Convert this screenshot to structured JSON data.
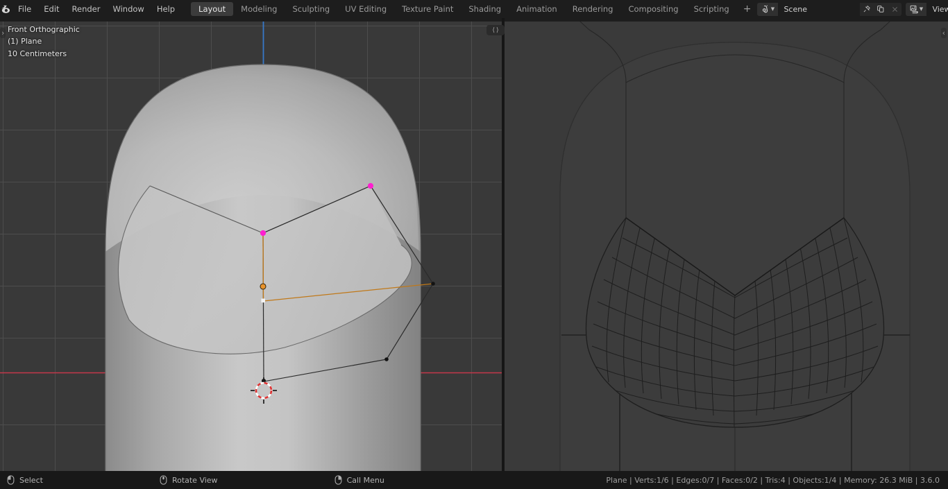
{
  "app": {
    "name": "Blender",
    "version_label": "3.6.0"
  },
  "topbar": {
    "logo_icon": "blender-logo-icon",
    "menus": [
      "File",
      "Edit",
      "Render",
      "Window",
      "Help"
    ],
    "workspace_tabs": [
      {
        "label": "Layout",
        "active": true
      },
      {
        "label": "Modeling",
        "active": false
      },
      {
        "label": "Sculpting",
        "active": false
      },
      {
        "label": "UV Editing",
        "active": false
      },
      {
        "label": "Texture Paint",
        "active": false
      },
      {
        "label": "Shading",
        "active": false
      },
      {
        "label": "Animation",
        "active": false
      },
      {
        "label": "Rendering",
        "active": false
      },
      {
        "label": "Compositing",
        "active": false
      },
      {
        "label": "Scripting",
        "active": false
      }
    ],
    "add_workspace_label": "+",
    "scene": {
      "icon": "scene-icon",
      "dropdown_icon": "chevron-down-icon",
      "value": "Scene",
      "pin_icon": "pin-icon",
      "new_icon": "duplicate-icon",
      "unlink_icon": "close-icon"
    },
    "view_layer": {
      "icon": "view-layer-icon",
      "dropdown_icon": "chevron-down-icon",
      "value": "View Layer",
      "new_icon": "duplicate-icon",
      "unlink_icon": "close-icon"
    }
  },
  "viewport_left": {
    "name": "3d-viewport-solid",
    "overlay": {
      "view_name": "Front Orthographic",
      "object_line": "(1) Plane",
      "grid_scale": "10 Centimeters"
    },
    "sidebar_toggle_icon": "chevron-right-icon",
    "colors": {
      "background": "#393939",
      "grid_line": "#505050",
      "x_axis": "#d9384a",
      "z_axis": "#3e7fd0",
      "object_surface_light": "#c4c4c4",
      "object_surface_dark": "#8e8e8e",
      "selected_vertex": "#ff22d0",
      "active_element": "#e08a12",
      "cursor_icon": "3d-cursor-icon"
    },
    "shading_mode": "solid",
    "mesh_vertices_visible": 6
  },
  "viewport_right": {
    "name": "3d-viewport-wireframe",
    "sidebar_toggle_icon": "chevron-left-icon",
    "splitter_icon": "expand-arrows-icon",
    "colors": {
      "background": "#3a3a3a",
      "wire": "#1f1f1f"
    },
    "shading_mode": "wireframe"
  },
  "statusbar": {
    "hints": [
      {
        "icon": "mouse-left-icon",
        "label": "Select"
      },
      {
        "icon": "mouse-middle-icon",
        "label": "Rotate View"
      },
      {
        "icon": "mouse-right-icon",
        "label": "Call Menu"
      }
    ],
    "stats": "Plane | Verts:1/6 | Edges:0/7 | Faces:0/2 | Tris:4 | Objects:1/4 | Memory: 26.3 MiB | 3.6.0",
    "stats_parts": {
      "object": "Plane",
      "verts": "Verts:1/6",
      "edges": "Edges:0/7",
      "faces": "Faces:0/2",
      "tris": "Tris:4",
      "objects": "Objects:1/4",
      "memory": "Memory: 26.3 MiB",
      "version": "3.6.0"
    }
  }
}
